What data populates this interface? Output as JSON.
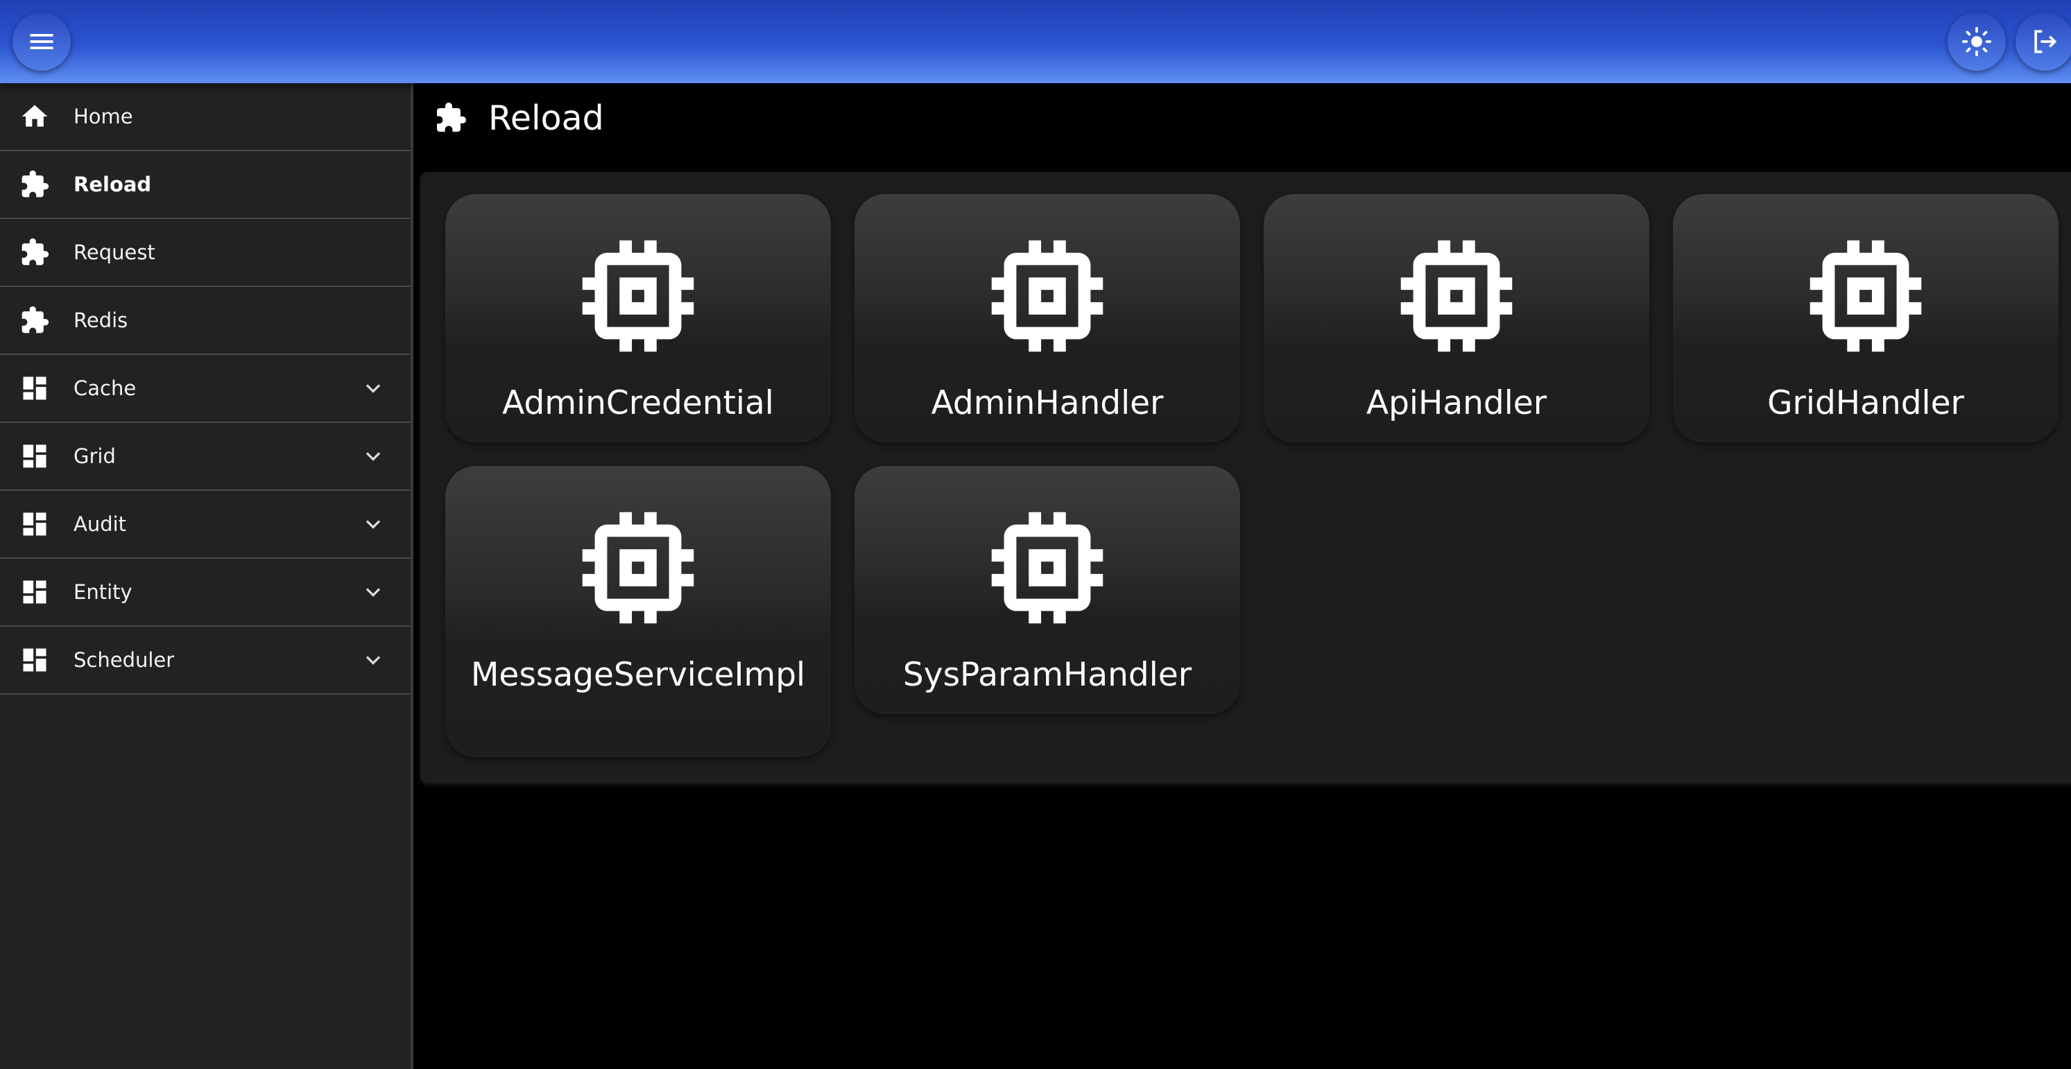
{
  "header": {
    "menu_icon": "menu-icon",
    "theme_icon": "sun-icon",
    "logout_icon": "logout-icon",
    "gradient_colors": [
      "#1f3fb4",
      "#5f8ff3"
    ]
  },
  "sidebar": {
    "items": [
      {
        "label": "Home",
        "icon": "home-icon"
      },
      {
        "label": "Reload",
        "icon": "puzzle-icon",
        "active": true
      },
      {
        "label": "Request",
        "icon": "puzzle-icon"
      },
      {
        "label": "Redis",
        "icon": "puzzle-icon"
      },
      {
        "label": "Cache",
        "icon": "dashboard-icon",
        "expandable": true
      },
      {
        "label": "Grid",
        "icon": "dashboard-icon",
        "expandable": true
      },
      {
        "label": "Audit",
        "icon": "dashboard-icon",
        "expandable": true
      },
      {
        "label": "Entity",
        "icon": "dashboard-icon",
        "expandable": true
      },
      {
        "label": "Scheduler",
        "icon": "dashboard-icon",
        "expandable": true
      }
    ]
  },
  "page": {
    "title": "Reload",
    "icon": "puzzle-icon"
  },
  "cards": [
    {
      "label": "AdminCredential",
      "icon": "chip-icon"
    },
    {
      "label": "AdminHandler",
      "icon": "chip-icon"
    },
    {
      "label": "ApiHandler",
      "icon": "chip-icon"
    },
    {
      "label": "GridHandler",
      "icon": "chip-icon"
    },
    {
      "label": "MessageServiceImpl",
      "icon": "chip-icon"
    },
    {
      "label": "SysParamHandler",
      "icon": "chip-icon"
    }
  ]
}
